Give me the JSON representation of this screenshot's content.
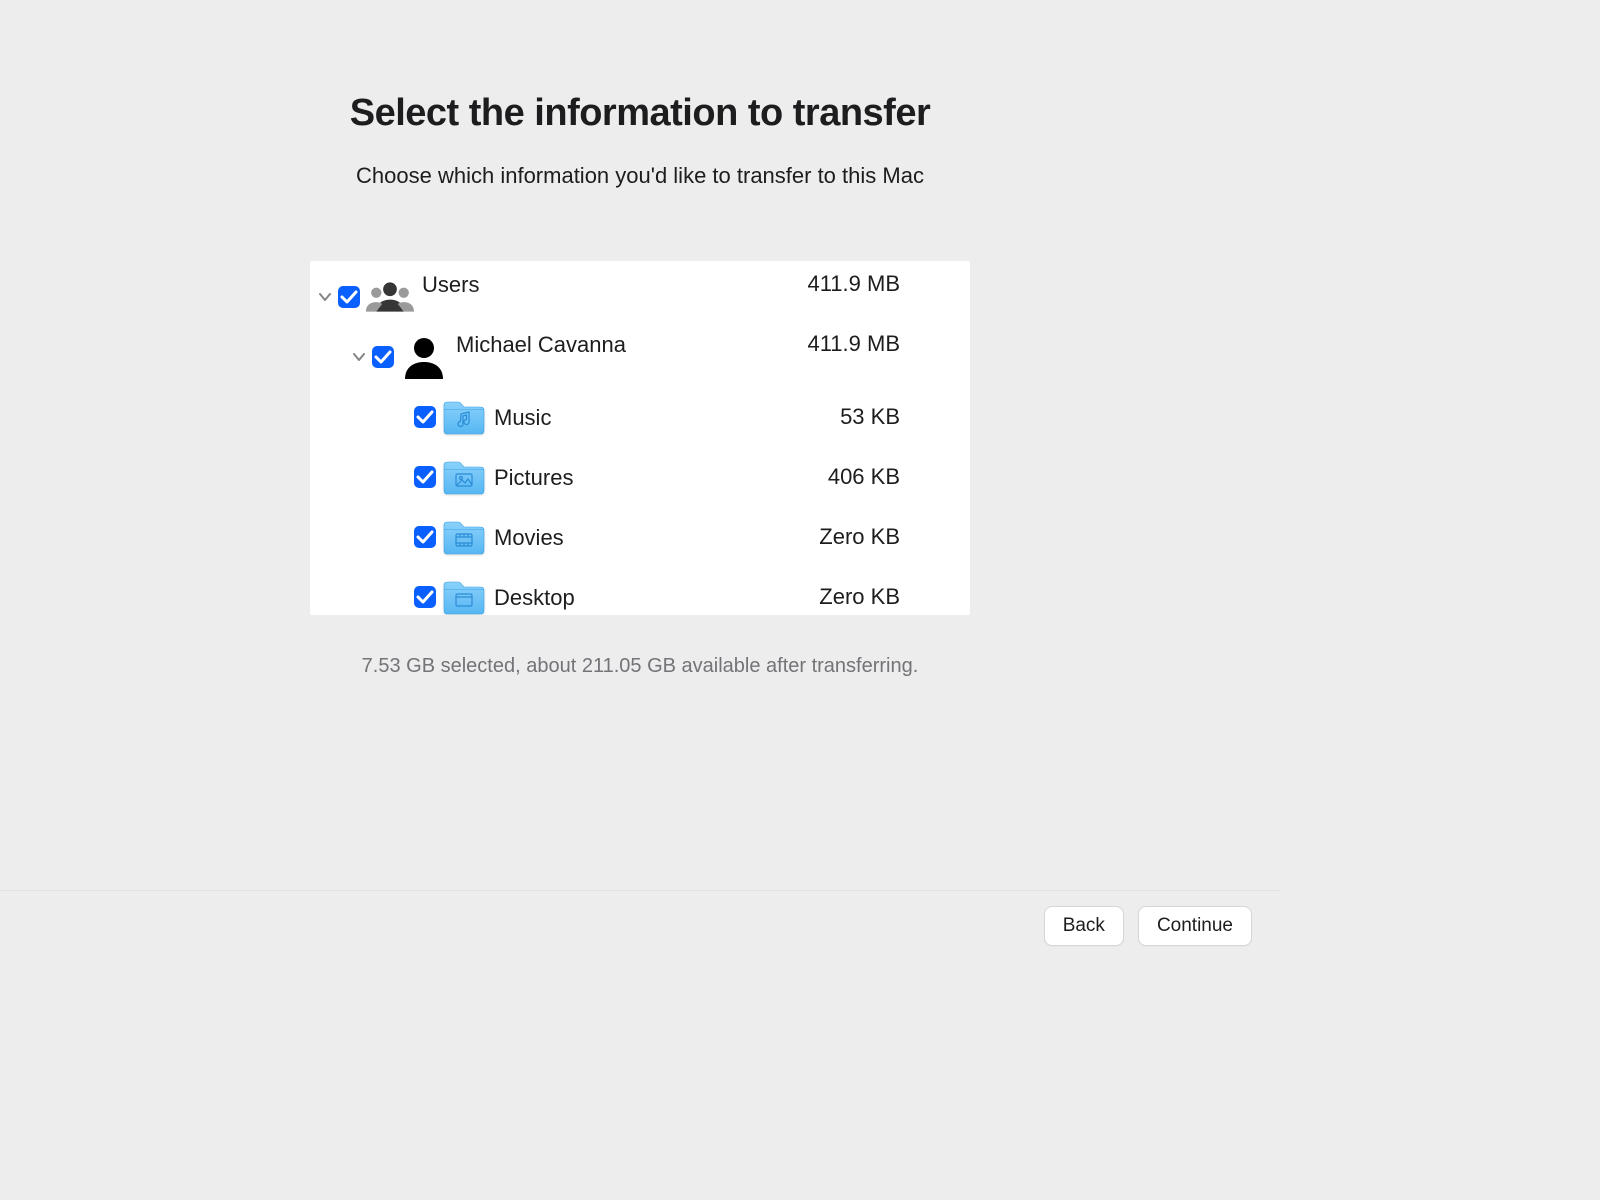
{
  "header": {
    "title": "Select the information to transfer",
    "subtitle": "Choose which information you'd like to transfer to this Mac"
  },
  "tree": {
    "root": {
      "label": "Users",
      "size": "411.9 MB"
    },
    "user": {
      "label": "Michael Cavanna",
      "size": "411.9 MB"
    },
    "folders": [
      {
        "label": "Music",
        "size": "53 KB"
      },
      {
        "label": "Pictures",
        "size": "406 KB"
      },
      {
        "label": "Movies",
        "size": "Zero KB"
      },
      {
        "label": "Desktop",
        "size": "Zero KB"
      }
    ]
  },
  "status": "7.53 GB selected, about 211.05 GB available after transferring.",
  "footer": {
    "back": "Back",
    "continue": "Continue"
  }
}
